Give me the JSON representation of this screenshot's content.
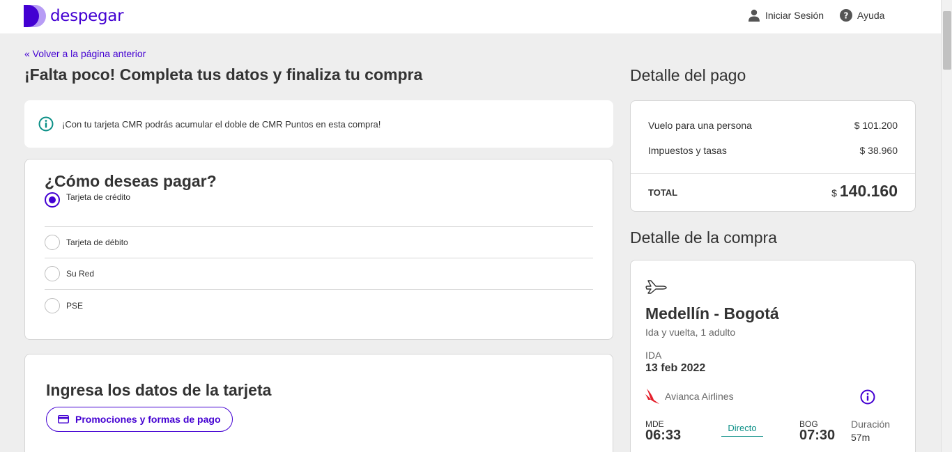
{
  "header": {
    "logo_text": "despegar",
    "login_label": "Iniciar Sesión",
    "help_label": "Ayuda"
  },
  "colors": {
    "brand": "#4300d2",
    "info": "#0a8f86",
    "background": "#eeeeee"
  },
  "back_link": "« Volver a la página anterior",
  "page_title": "¡Falta poco! Completa tus datos y finaliza tu compra",
  "promo_banner": {
    "icon": "info-circle-icon",
    "text": "¡Con tu tarjeta CMR podrás acumular el doble de CMR Puntos en esta compra!"
  },
  "payment": {
    "title": "¿Cómo deseas pagar?",
    "options": [
      {
        "label": "Tarjeta de crédito",
        "selected": true
      },
      {
        "label": "Tarjeta de débito",
        "selected": false
      },
      {
        "label": "Su Red",
        "selected": false
      },
      {
        "label": "PSE",
        "selected": false
      }
    ]
  },
  "card_form": {
    "title": "Ingresa los datos de la tarjeta",
    "promo_button": "Promociones y formas de pago"
  },
  "payment_detail": {
    "title": "Detalle del pago",
    "rows": [
      {
        "label": "Vuelo para una persona",
        "value": "$ 101.200"
      },
      {
        "label": "Impuestos y tasas",
        "value": "$ 38.960"
      }
    ],
    "total_label": "TOTAL",
    "total_currency": "$",
    "total_amount": "140.160"
  },
  "purchase_detail": {
    "title": "Detalle de la compra",
    "route": "Medellín - Bogotá",
    "subtitle": "Ida y vuelta, 1 adulto",
    "leg_label": "IDA",
    "leg_date": "13 feb 2022",
    "airline": "Avianca Airlines",
    "origin_code": "MDE",
    "origin_time": "06:33",
    "stop_type": "Directo",
    "dest_code": "BOG",
    "dest_time": "07:30",
    "duration_label": "Duración",
    "duration_value": "57m"
  }
}
